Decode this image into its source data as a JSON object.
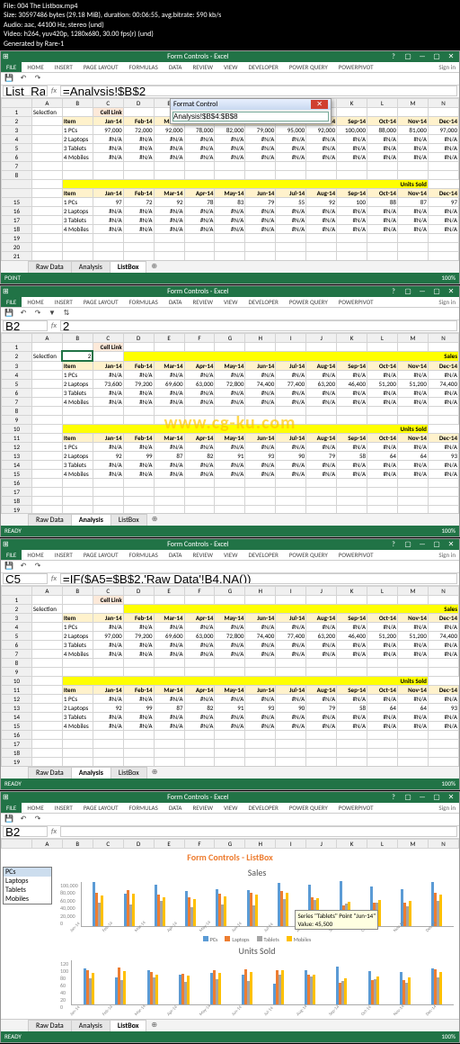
{
  "file_info": {
    "line1": "File: 004 The Listbox.mp4",
    "line2": "Size: 30597486 bytes (29.18 MiB), duration: 00:06:55, avg.bitrate: 590 kb/s",
    "line3": "Audio: aac, 44100 Hz, stereo (und)",
    "line4": "Video: h264, yuv420p, 1280x680, 30.00 fps(r) (und)",
    "line5": "Generated by Rare-1"
  },
  "app_title": "Form Controls - Excel",
  "ribbon": {
    "file": "FILE",
    "tabs": [
      "HOME",
      "INSERT",
      "PAGE LAYOUT",
      "FORMULAS",
      "DATA",
      "REVIEW",
      "VIEW",
      "DEVELOPER",
      "POWER QUERY",
      "POWERPIVOT"
    ],
    "signin": "Sign in"
  },
  "columns": [
    "",
    "A",
    "B",
    "C",
    "D",
    "E",
    "F",
    "G",
    "H",
    "I",
    "J",
    "K",
    "L",
    "M",
    "N"
  ],
  "months": [
    "Jan-14",
    "Feb-14",
    "Mar-14",
    "Apr-14",
    "May-14",
    "Jun-14",
    "Jul-14",
    "Aug-14",
    "Sep-14",
    "Oct-14",
    "Nov-14",
    "Dec-14"
  ],
  "items": [
    "PCs",
    "Laptops",
    "Tablets",
    "Mobiles"
  ],
  "labels": {
    "selection": "Selection",
    "cell_link": "Cell Link",
    "sales": "Sales",
    "units": "Units Sold",
    "item": "Item"
  },
  "sheet_tabs": [
    "Raw Data",
    "Analysis",
    "ListBox"
  ],
  "status": {
    "ready": "READY",
    "point": "POINT",
    "zoom": "100%"
  },
  "pane1": {
    "namebox": "List_Range",
    "formula": "=Analysis!$B$2",
    "active_tab": "ListBox",
    "dialog": {
      "title": "Format Control",
      "value": "Analysis!$B$4:$B$8"
    },
    "sales": {
      "PCs": [
        97000,
        72000,
        92000,
        78000,
        82000,
        79000,
        95000,
        92000,
        100000,
        88000,
        81000,
        97000
      ],
      "row_na": [
        "#N/A",
        "#N/A",
        "#N/A",
        "#N/A",
        "#N/A",
        "#N/A",
        "#N/A",
        "#N/A",
        "#N/A",
        "#N/A",
        "#N/A",
        "#N/A"
      ]
    },
    "units": {
      "PCs": [
        97,
        72,
        92,
        78,
        83,
        79,
        55,
        92,
        100,
        88,
        87,
        97
      ],
      "row_na": [
        "#N/A",
        "#N/A",
        "#N/A",
        "#N/A",
        "#N/A",
        "#N/A",
        "#N/A",
        "#N/A",
        "#N/A",
        "#N/A",
        "#N/A",
        "#N/A"
      ]
    }
  },
  "pane2": {
    "namebox": "B2",
    "formula": "2",
    "cell_link_value": "2",
    "active_tab": "Analysis",
    "sales": {
      "PCs": [
        "#N/A",
        "#N/A",
        "#N/A",
        "#N/A",
        "#N/A",
        "#N/A",
        "#N/A",
        "#N/A",
        "#N/A",
        "#N/A",
        "#N/A",
        "#N/A"
      ],
      "Laptops": [
        73600,
        79200,
        69600,
        63000,
        72800,
        74400,
        77400,
        63200,
        46400,
        51200,
        51200,
        74400
      ],
      "Tablets": [
        "#N/A",
        "#N/A",
        "#N/A",
        "#N/A",
        "#N/A",
        "#N/A",
        "#N/A",
        "#N/A",
        "#N/A",
        "#N/A",
        "#N/A",
        "#N/A"
      ],
      "Mobiles": [
        "#N/A",
        "#N/A",
        "#N/A",
        "#N/A",
        "#N/A",
        "#N/A",
        "#N/A",
        "#N/A",
        "#N/A",
        "#N/A",
        "#N/A",
        "#N/A"
      ]
    },
    "units": {
      "PCs": [
        "#N/A",
        "#N/A",
        "#N/A",
        "#N/A",
        "#N/A",
        "#N/A",
        "#N/A",
        "#N/A",
        "#N/A",
        "#N/A",
        "#N/A",
        "#N/A"
      ],
      "Laptops": [
        92,
        99,
        87,
        82,
        91,
        93,
        90,
        79,
        58,
        64,
        64,
        93
      ],
      "Tablets": [
        "#N/A",
        "#N/A",
        "#N/A",
        "#N/A",
        "#N/A",
        "#N/A",
        "#N/A",
        "#N/A",
        "#N/A",
        "#N/A",
        "#N/A",
        "#N/A"
      ],
      "Mobiles": [
        "#N/A",
        "#N/A",
        "#N/A",
        "#N/A",
        "#N/A",
        "#N/A",
        "#N/A",
        "#N/A",
        "#N/A",
        "#N/A",
        "#N/A",
        "#N/A"
      ]
    },
    "watermark": "www.cg-ku.com"
  },
  "pane3": {
    "namebox": "C5",
    "formula": "=IF($A5=$B$2,'Raw Data'!B4,NA())",
    "active_tab": "Analysis",
    "sales": {
      "PCs": [
        "#N/A",
        "#N/A",
        "#N/A",
        "#N/A",
        "#N/A",
        "#N/A",
        "#N/A",
        "#N/A",
        "#N/A",
        "#N/A",
        "#N/A",
        "#N/A"
      ],
      "Laptops": [
        97000,
        79200,
        69600,
        63000,
        72800,
        74400,
        77400,
        63200,
        46400,
        51200,
        51200,
        74400
      ],
      "Tablets": [
        "#N/A",
        "#N/A",
        "#N/A",
        "#N/A",
        "#N/A",
        "#N/A",
        "#N/A",
        "#N/A",
        "#N/A",
        "#N/A",
        "#N/A",
        "#N/A"
      ],
      "Mobiles": [
        "#N/A",
        "#N/A",
        "#N/A",
        "#N/A",
        "#N/A",
        "#N/A",
        "#N/A",
        "#N/A",
        "#N/A",
        "#N/A",
        "#N/A",
        "#N/A"
      ]
    },
    "units": {
      "PCs": [
        "#N/A",
        "#N/A",
        "#N/A",
        "#N/A",
        "#N/A",
        "#N/A",
        "#N/A",
        "#N/A",
        "#N/A",
        "#N/A",
        "#N/A",
        "#N/A"
      ],
      "Laptops": [
        92,
        99,
        87,
        82,
        91,
        93,
        90,
        79,
        58,
        64,
        64,
        93
      ],
      "Tablets": [
        "#N/A",
        "#N/A",
        "#N/A",
        "#N/A",
        "#N/A",
        "#N/A",
        "#N/A",
        "#N/A",
        "#N/A",
        "#N/A",
        "#N/A",
        "#N/A"
      ],
      "Mobiles": [
        "#N/A",
        "#N/A",
        "#N/A",
        "#N/A",
        "#N/A",
        "#N/A",
        "#N/A",
        "#N/A",
        "#N/A",
        "#N/A",
        "#N/A",
        "#N/A"
      ]
    }
  },
  "pane4": {
    "namebox": "B2",
    "formula": "",
    "active_tab": "ListBox",
    "section_title": "Form Controls - ListBox",
    "listbox_sel": "PCs",
    "tooltip": "Series \"Tablets\" Point \"Jun-14\"\nValue: 45,500",
    "chart_data": [
      {
        "type": "bar",
        "title": "Sales",
        "xlabel": "",
        "ylabel": "",
        "ylim": [
          0,
          100000
        ],
        "yticks": [
          0,
          20000,
          40000,
          60000,
          80000,
          100000
        ],
        "categories": [
          "Jan-14",
          "Feb-14",
          "Mar-14",
          "Apr-14",
          "May-14",
          "Jun-14",
          "Jul-14",
          "Aug-14",
          "Sep-14",
          "Oct-14",
          "Nov-14",
          "Dec-14"
        ],
        "series": [
          {
            "name": "PCs",
            "values": [
              97000,
              72000,
              92000,
              78000,
              82000,
              79000,
              95000,
              92000,
              100000,
              88000,
              81000,
              97000
            ]
          },
          {
            "name": "Laptops",
            "values": [
              73600,
              79200,
              69600,
              63000,
              72800,
              74400,
              77400,
              63200,
              46400,
              51200,
              51200,
              74400
            ]
          },
          {
            "name": "Tablets",
            "values": [
              52000,
              48000,
              55000,
              41000,
              47000,
              45500,
              60000,
              58000,
              49000,
              51000,
              43000,
              56000
            ]
          },
          {
            "name": "Mobiles",
            "values": [
              68000,
              71000,
              64000,
              59000,
              66000,
              70000,
              73000,
              61000,
              54000,
              58000,
              55000,
              69000
            ]
          }
        ],
        "legend_position": "bottom"
      },
      {
        "type": "bar",
        "title": "Units Sold",
        "xlabel": "",
        "ylabel": "",
        "ylim": [
          0,
          120
        ],
        "yticks": [
          0,
          20,
          40,
          60,
          80,
          100,
          120
        ],
        "categories": [
          "Jan-14",
          "Feb-14",
          "Mar-14",
          "Apr-14",
          "May-14",
          "Jun-14",
          "Jul-14",
          "Aug-14",
          "Sep-14",
          "Oct-14",
          "Nov-14",
          "Dec-14"
        ],
        "series": [
          {
            "name": "PCs",
            "values": [
              97,
              72,
              92,
              78,
              83,
              79,
              55,
              92,
              100,
              88,
              87,
              97
            ]
          },
          {
            "name": "Laptops",
            "values": [
              92,
              99,
              87,
              82,
              91,
              93,
              90,
              79,
              58,
              64,
              64,
              93
            ]
          },
          {
            "name": "Tablets",
            "values": [
              70,
              65,
              72,
              60,
              66,
              63,
              78,
              74,
              62,
              67,
              58,
              73
            ]
          },
          {
            "name": "Mobiles",
            "values": [
              85,
              88,
              80,
              76,
              83,
              87,
              91,
              78,
              70,
              74,
              72,
              86
            ]
          }
        ],
        "legend_position": "bottom"
      }
    ]
  }
}
